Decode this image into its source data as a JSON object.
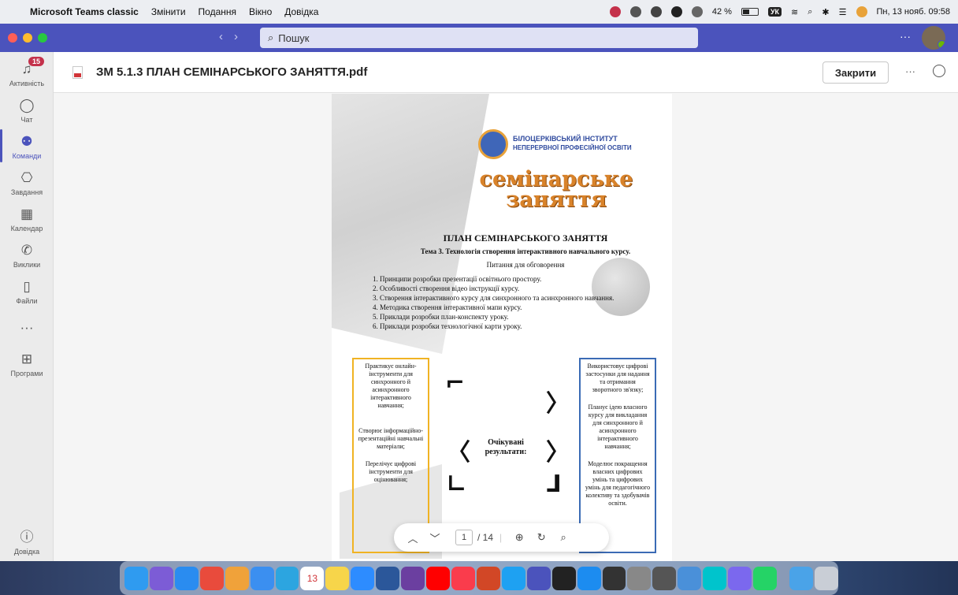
{
  "menubar": {
    "app_name": "Microsoft Teams classic",
    "menus": [
      "Змінити",
      "Подання",
      "Вікно",
      "Довідка"
    ],
    "battery": "42 %",
    "keyboard_layout": "УК",
    "datetime": "Пн, 13 нояб. 09:58"
  },
  "titlebar": {
    "search_placeholder": "Пошук",
    "more": "···"
  },
  "rail": {
    "items": [
      {
        "label": "Активність",
        "icon": "bell-icon",
        "badge": "15"
      },
      {
        "label": "Чат",
        "icon": "chat-icon"
      },
      {
        "label": "Команди",
        "icon": "teams-icon"
      },
      {
        "label": "Завдання",
        "icon": "assignments-icon"
      },
      {
        "label": "Календар",
        "icon": "calendar-icon"
      },
      {
        "label": "Виклики",
        "icon": "phone-icon"
      },
      {
        "label": "Файли",
        "icon": "file-icon"
      },
      {
        "label": "···",
        "icon": "more-icon"
      },
      {
        "label": "Програми",
        "icon": "apps-icon"
      },
      {
        "label": "Довідка",
        "icon": "help-icon"
      }
    ]
  },
  "document": {
    "title": "ЗМ 5.1.3 ПЛАН СЕМІНАРСЬКОГО ЗАНЯТТЯ.pdf",
    "close_label": "Закрити",
    "more": "···"
  },
  "pdf": {
    "institute_line1": "БІЛОЦЕРКІВСЬКИЙ ІНСТИТУТ",
    "institute_line2": "НЕПЕРЕРВНОЇ ПРОФЕСІЙНОЇ ОСВІТИ",
    "banner_line1": "семінарське",
    "banner_line2": "заняття",
    "plan_title": "ПЛАН СЕМІНАРСЬКОГО ЗАНЯТТЯ",
    "topic": "Тема 3. Технологія створення інтерактивного навчального курсу.",
    "questions_heading": "Питання для обговорення",
    "questions": [
      "1. Принципи розробки презентації освітнього простору.",
      "2. Особливості створення відео інструкції курсу.",
      "3. Створення інтерактивного курсу для синхронного та асинхронного навчання.",
      "4. Методика створення інтерактивної мапи курсу.",
      "5. Приклади розробки план-конспекту уроку.",
      "6. Приклади розробки технологічної карти уроку."
    ],
    "left_column": [
      "Практикує онлайн-інструменти для синхронного й асинхронного інтерактивного навчання;",
      "Створює інформаційно-презентаційні навчальні матеріали;",
      "Перелічує цифрові інструменти для оцінювання;"
    ],
    "right_column": [
      "Використовує цифрові застосунки для надання та отримання зворотного зв'язку;",
      "Планує ідею власного курсу для викладання для синхронного й асинхронного інтерактивного навчання;",
      "Моделює покращення власних цифрових умінь та цифрових умінь для педагогічного колективу та здобувачів освіти."
    ],
    "center_label": "Очікувані результати:",
    "current_page": "1",
    "total_pages": "/ 14"
  },
  "colors": {
    "teams_purple": "#4b53bc",
    "left_border": "#f0b323",
    "right_border": "#3b6bb5",
    "badge": "#c4314b"
  },
  "dock": {
    "calendar_day": "13"
  }
}
